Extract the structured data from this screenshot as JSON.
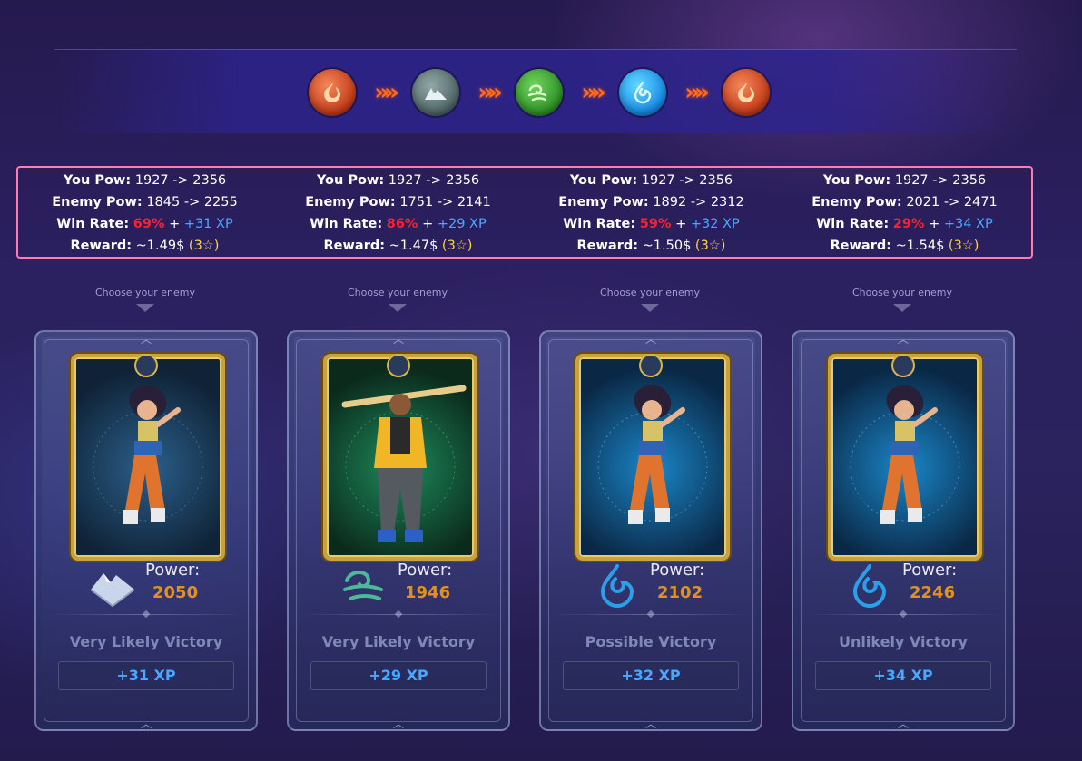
{
  "element_sequence": [
    {
      "icon": "fire-element-icon",
      "color": "#d9461c"
    },
    {
      "icon": "earth-element-icon",
      "color": "#5f7878"
    },
    {
      "icon": "wind-element-icon",
      "color": "#3aa32c"
    },
    {
      "icon": "water-element-icon",
      "color": "#1c9ef0"
    },
    {
      "icon": "fire-element-icon",
      "color": "#d9461c"
    }
  ],
  "stats": [
    {
      "you_label": "You Pow:",
      "you_value": "1927 -> 2356",
      "enemy_label": "Enemy Pow:",
      "enemy_value": "1845 -> 2255",
      "win_label": "Win Rate:",
      "win_rate": "69%",
      "plus": "+",
      "xp": "+31 XP",
      "reward_label": "Reward:",
      "reward": "~1.49$",
      "stars": "(3☆)"
    },
    {
      "you_label": "You Pow:",
      "you_value": "1927 -> 2356",
      "enemy_label": "Enemy Pow:",
      "enemy_value": "1751 -> 2141",
      "win_label": "Win Rate:",
      "win_rate": "86%",
      "plus": "+",
      "xp": "+29 XP",
      "reward_label": "Reward:",
      "reward": "~1.47$",
      "stars": "(3☆)"
    },
    {
      "you_label": "You Pow:",
      "you_value": "1927 -> 2356",
      "enemy_label": "Enemy Pow:",
      "enemy_value": "1892 -> 2312",
      "win_label": "Win Rate:",
      "win_rate": "59%",
      "plus": "+",
      "xp": "+32 XP",
      "reward_label": "Reward:",
      "reward": "~1.50$",
      "stars": "(3☆)"
    },
    {
      "you_label": "You Pow:",
      "you_value": "1927 -> 2356",
      "enemy_label": "Enemy Pow:",
      "enemy_value": "2021 -> 2471",
      "win_label": "Win Rate:",
      "win_rate": "29%",
      "plus": "+",
      "xp": "+34 XP",
      "reward_label": "Reward:",
      "reward": "~1.54$",
      "stars": "(3☆)"
    }
  ],
  "choose_label": "Choose your enemy",
  "enemies": [
    {
      "element": "earth",
      "element_icon": "mountain-icon",
      "power_label": "Power:",
      "power": "2050",
      "verdict": "Very Likely Victory",
      "xp": "+31 XP",
      "portrait": "fighter-girl-portrait"
    },
    {
      "element": "wind",
      "element_icon": "wind-swirl-icon",
      "power_label": "Power:",
      "power": "1946",
      "verdict": "Very Likely Victory",
      "xp": "+29 XP",
      "portrait": "batter-man-portrait"
    },
    {
      "element": "water",
      "element_icon": "water-drop-icon",
      "power_label": "Power:",
      "power": "2102",
      "verdict": "Possible Victory",
      "xp": "+32 XP",
      "portrait": "fighter-girl-portrait"
    },
    {
      "element": "water",
      "element_icon": "water-drop-icon",
      "power_label": "Power:",
      "power": "2246",
      "verdict": "Unlikely Victory",
      "xp": "+34 XP",
      "portrait": "fighter-girl-portrait"
    }
  ],
  "colors": {
    "win_rate": "#ff1f2d",
    "xp": "#4aa7ff",
    "stars": "#ffd23a",
    "power_value": "#e09125",
    "stats_border": "#ff7bb2"
  }
}
